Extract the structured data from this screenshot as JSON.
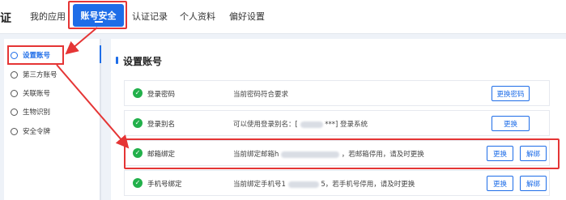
{
  "topnav": {
    "brand": "证",
    "tabs": [
      "我的应用",
      "账号安全",
      "认证记录",
      "个人资料",
      "偏好设置"
    ]
  },
  "sidebar": {
    "items": [
      {
        "label": "设置账号",
        "active": true
      },
      {
        "label": "第三方账号"
      },
      {
        "label": "关联账号"
      },
      {
        "label": "生物识别"
      },
      {
        "label": "安全令牌"
      }
    ]
  },
  "main": {
    "title": "设置账号",
    "rows": [
      {
        "name": "登录密码",
        "desc": "当前密码符合要求",
        "buttons": [
          "更换密码"
        ]
      },
      {
        "name": "登录别名",
        "desc_pre": "可以使用登录别名：[",
        "desc_post": "***] 登录系统",
        "buttons": [
          "更换"
        ]
      },
      {
        "name": "邮箱绑定",
        "desc_pre": "当前绑定邮箱h",
        "desc_post": "，若邮箱停用，请及时更换",
        "buttons": [
          "更换",
          "解绑"
        ]
      },
      {
        "name": "手机号绑定",
        "desc_pre": "当前绑定手机号1",
        "desc_post": "5，若手机号停用，请及时更换",
        "buttons": [
          "更换",
          "解绑"
        ]
      }
    ]
  },
  "colors": {
    "accent": "#1e6de8",
    "annotation": "#e53535",
    "success": "#22b04b"
  }
}
